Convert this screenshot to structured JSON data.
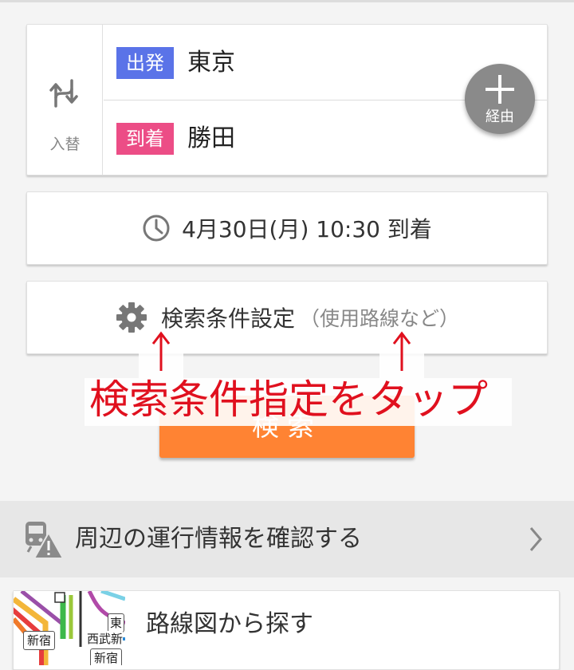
{
  "stations": {
    "swap_label": "入替",
    "departure": {
      "badge": "出発",
      "name": "東京",
      "badge_color": "#5a73e8"
    },
    "arrival": {
      "badge": "到着",
      "name": "勝田",
      "badge_color": "#ec4d86"
    },
    "via_label": "経由"
  },
  "datetime": {
    "text": "4月30日(月) 10:30 到着"
  },
  "conditions": {
    "label": "検索条件設定",
    "sub": "（使用路線など）"
  },
  "search_button": {
    "label": "検索",
    "color": "#ff8333"
  },
  "annotation": {
    "text": "検索条件指定をタップ",
    "color": "#e0101e"
  },
  "info_bar": {
    "label": "周辺の運行情報を確認する"
  },
  "route_map": {
    "label": "路線図から探す",
    "thumb_labels": [
      "新宿",
      "東",
      "西武新",
      "新宿"
    ]
  },
  "icons": {
    "swap": "swap-vertical-icon",
    "via": "plus-icon",
    "clock": "clock-icon",
    "gear": "gear-icon",
    "train_warning": "train-warning-icon",
    "chevron": "chevron-right-icon"
  }
}
